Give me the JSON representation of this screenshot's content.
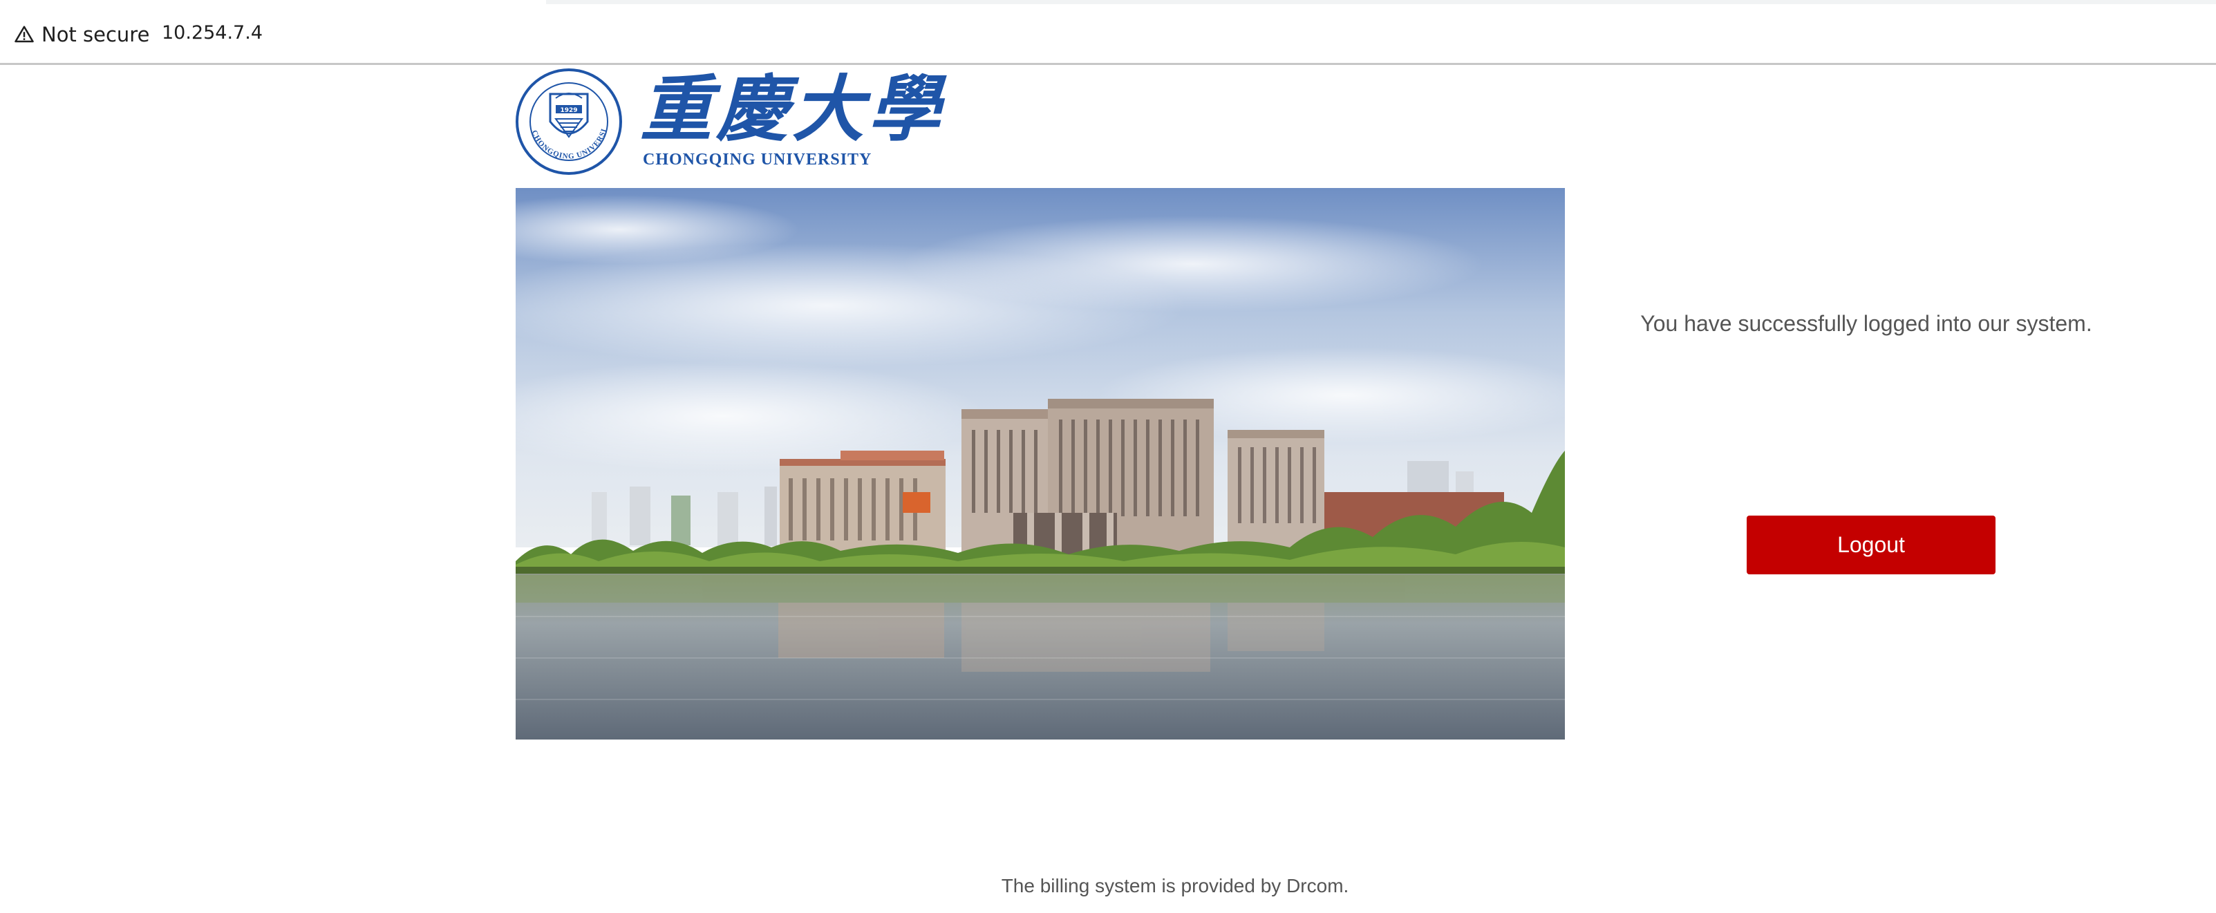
{
  "browser": {
    "security_label": "Not secure",
    "url": "10.254.7.4",
    "security_icon": "warning-triangle-icon"
  },
  "logo": {
    "seal_year": "1929",
    "seal_text": "CHONGQING UNIVERSITY",
    "name_cn": "重慶大學",
    "name_en": "CHONGQING UNIVERSITY",
    "color": "#1f55a8"
  },
  "main": {
    "success_message": "You have successfully logged into our system.",
    "logout_label": "Logout",
    "logout_color": "#c40000"
  },
  "footer": {
    "text": "The billing system is provided by Drcom."
  }
}
